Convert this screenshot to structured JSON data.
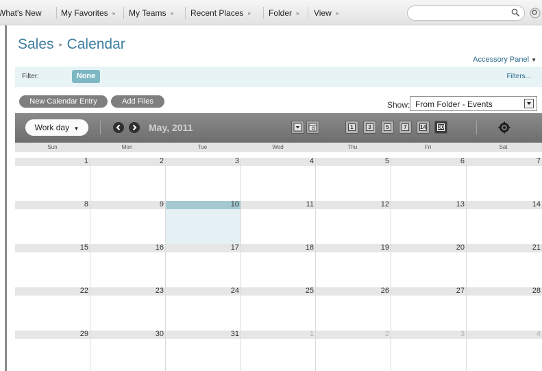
{
  "nav": {
    "items": [
      {
        "label": "What's New",
        "arrow": ""
      },
      {
        "label": "My Favorites",
        "arrow": "»"
      },
      {
        "label": "My Teams",
        "arrow": "»"
      },
      {
        "label": "Recent Places",
        "arrow": "»"
      },
      {
        "label": "Folder",
        "arrow": "»"
      },
      {
        "label": "View",
        "arrow": "»"
      }
    ],
    "search_placeholder": "",
    "icons": [
      "search-icon",
      "extra-icon"
    ]
  },
  "header": {
    "breadcrumb_root": "Sales",
    "breadcrumb_sep": "▸",
    "breadcrumb_current": "Calendar",
    "accessory_panel": "Accessory Panel"
  },
  "filter": {
    "label": "Filter:",
    "value": "None",
    "filters_link": "Filters..."
  },
  "actions": {
    "new_entry": "New Calendar Entry",
    "add_files": "Add Files",
    "show_label": "Show:",
    "show_value": "From Folder - Events"
  },
  "toolbar": {
    "workday": "Work day",
    "month": "May, 2011",
    "views": [
      "1",
      "3",
      "5",
      "7",
      "14",
      "30"
    ],
    "active_view": "30"
  },
  "calendar": {
    "days_of_week": [
      "Sun",
      "Mon",
      "Tue",
      "Wed",
      "Thu",
      "Fri",
      "Sat"
    ],
    "weeks": [
      [
        {
          "d": "1"
        },
        {
          "d": "2"
        },
        {
          "d": "3"
        },
        {
          "d": "4"
        },
        {
          "d": "5"
        },
        {
          "d": "6"
        },
        {
          "d": "7"
        }
      ],
      [
        {
          "d": "8"
        },
        {
          "d": "9"
        },
        {
          "d": "10",
          "today": true
        },
        {
          "d": "11"
        },
        {
          "d": "12"
        },
        {
          "d": "13"
        },
        {
          "d": "14"
        }
      ],
      [
        {
          "d": "15"
        },
        {
          "d": "16"
        },
        {
          "d": "17"
        },
        {
          "d": "18"
        },
        {
          "d": "19"
        },
        {
          "d": "20"
        },
        {
          "d": "21"
        }
      ],
      [
        {
          "d": "22"
        },
        {
          "d": "23"
        },
        {
          "d": "24"
        },
        {
          "d": "25"
        },
        {
          "d": "26"
        },
        {
          "d": "27"
        },
        {
          "d": "28"
        }
      ],
      [
        {
          "d": "29"
        },
        {
          "d": "30"
        },
        {
          "d": "31"
        },
        {
          "d": "1",
          "other": true
        },
        {
          "d": "2",
          "other": true
        },
        {
          "d": "3",
          "other": true
        },
        {
          "d": "4",
          "other": true
        }
      ]
    ]
  },
  "colors": {
    "link": "#3f7fa0",
    "filter_bg": "#e8f3f6",
    "today_bg": "#e4f0f3",
    "today_head": "#a4c9d1",
    "toolbar_bg": "#7c7c7c"
  }
}
